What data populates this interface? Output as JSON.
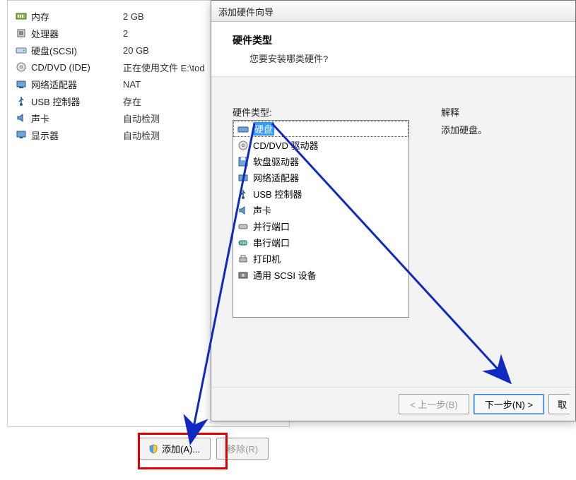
{
  "settings": [
    {
      "icon": "memory-icon",
      "label": "内存",
      "value": "2 GB"
    },
    {
      "icon": "cpu-icon",
      "label": "处理器",
      "value": "2"
    },
    {
      "icon": "hdd-icon",
      "label": "硬盘(SCSI)",
      "value": "20 GB"
    },
    {
      "icon": "cd-icon",
      "label": "CD/DVD (IDE)",
      "value": "正在使用文件 E:\\tod"
    },
    {
      "icon": "network-icon",
      "label": "网络适配器",
      "value": "NAT"
    },
    {
      "icon": "usb-icon",
      "label": "USB 控制器",
      "value": "存在"
    },
    {
      "icon": "sound-icon",
      "label": "声卡",
      "value": "自动检测"
    },
    {
      "icon": "display-icon",
      "label": "显示器",
      "value": "自动检测"
    }
  ],
  "buttons": {
    "add": "添加(A)...",
    "remove": "移除(R)"
  },
  "wizard": {
    "title": "添加硬件向导",
    "header_title": "硬件类型",
    "header_sub": "您要安装哪类硬件?",
    "hw_types_label": "硬件类型:",
    "hw_types": [
      {
        "icon": "hdd-icon",
        "label": "硬盘",
        "selected": true
      },
      {
        "icon": "cd-icon",
        "label": "CD/DVD 驱动器"
      },
      {
        "icon": "floppy-icon",
        "label": "软盘驱动器"
      },
      {
        "icon": "network-icon",
        "label": "网络适配器"
      },
      {
        "icon": "usb-icon",
        "label": "USB 控制器"
      },
      {
        "icon": "sound-icon",
        "label": "声卡"
      },
      {
        "icon": "parallel-icon",
        "label": "并行端口"
      },
      {
        "icon": "serial-icon",
        "label": "串行端口"
      },
      {
        "icon": "printer-icon",
        "label": "打印机"
      },
      {
        "icon": "scsi-icon",
        "label": "通用 SCSI 设备"
      }
    ],
    "explain_label": "解释",
    "explain_text": "添加硬盘。",
    "back": "< 上一步(B)",
    "next": "下一步(N) >",
    "cancel_partial": "取"
  },
  "colors": {
    "arrow": "#1029c2",
    "highlight": "#e00000"
  }
}
